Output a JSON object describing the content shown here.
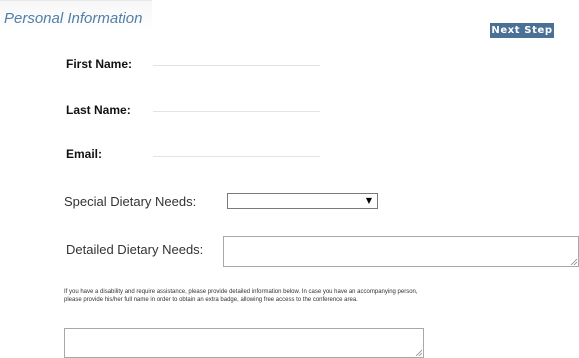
{
  "section": {
    "title": "Personal Information",
    "next_label": "Next Step"
  },
  "fields": {
    "first_name": {
      "label": "First Name:",
      "value": ""
    },
    "last_name": {
      "label": "Last Name:",
      "value": ""
    },
    "email": {
      "label": "Email:",
      "value": ""
    }
  },
  "dietary": {
    "special_label": "Special Dietary Needs:",
    "special_selected": "",
    "detailed_label": "Detailed Dietary Needs:",
    "detailed_value": ""
  },
  "assistance": {
    "notice_line1": "If you have a disability and require assistance, please provide detailed information below. In case you have an accompanying person,",
    "notice_line2": "please provide his/her full name in order to obtain an extra badge, allowing free access to the conference area.",
    "value": ""
  },
  "icons": {
    "select_arrow": "caret-down-icon",
    "resize": "resize-grip-icon"
  },
  "colors": {
    "title": "#4f7fa8",
    "button": "#4a7096",
    "button_text": "#ffffff"
  }
}
